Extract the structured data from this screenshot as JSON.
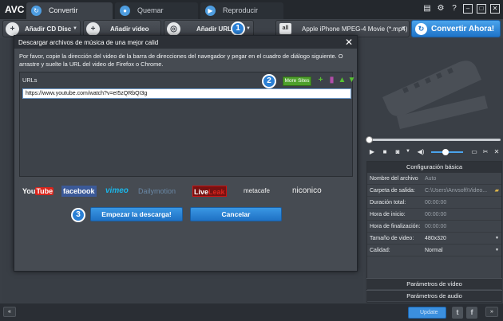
{
  "app": {
    "logo": "AVC"
  },
  "tabs": [
    {
      "label": "Convertir",
      "icon": "convert-icon",
      "active": true
    },
    {
      "label": "Quemar",
      "icon": "disc-icon",
      "active": false
    },
    {
      "label": "Reproducir",
      "icon": "play-icon",
      "active": false
    }
  ],
  "window": {
    "min": "–",
    "restore": "□",
    "close": "✕",
    "help": "?"
  },
  "toolbar": {
    "add_cd": "Añadir CD Disc",
    "add_video": "Añadir video",
    "add_url": "Añadir URL",
    "profile": "Apple iPhone MPEG-4 Movie (*.mp4)",
    "profile_icon_text": "all",
    "convert": "Convertir Ahora!"
  },
  "badges": {
    "one": "1",
    "two": "2",
    "three": "3"
  },
  "dialog": {
    "title": "Descargar archivos de música de una mejor calid",
    "description": "Por favor, copie la dirección del video de la barra de direcciones del navegador y pegar en el cuadro de diálogo siguiente. O arrastre y suelte la URL del video de Firefox o Chrome.",
    "urls_label": "URLs",
    "more_sites": "More Sites",
    "url_value": "https://www.youtube.com/watch?v=eI5zQRbQI3g",
    "start": "Empezar la descarga!",
    "cancel": "Cancelar"
  },
  "sites": {
    "youtube_you": "You",
    "youtube_tube": "Tube",
    "facebook": "facebook",
    "vimeo": "vimeo",
    "dailymotion": "Dailymotion",
    "liveleak_live": "Live",
    "liveleak_leak": "Leak",
    "metacafe": "metacafe",
    "niconico": "niconico"
  },
  "settings": {
    "header": "Configuración básica",
    "rows": [
      {
        "label": "Nombre del archivo",
        "value": "Auto"
      },
      {
        "label": "Carpeta de salida:",
        "value": "C:\\Users\\Anvsoft\\Video..."
      },
      {
        "label": "Duración total:",
        "value": "00:00:00"
      },
      {
        "label": "Hora de inicio:",
        "value": "00:00:00"
      },
      {
        "label": "Hora de finalización:",
        "value": "00:00:00"
      },
      {
        "label": "Tamaño de video:",
        "value": "480x320"
      },
      {
        "label": "Calidad:",
        "value": "Normal"
      }
    ],
    "video_params": "Parámetros de vídeo",
    "audio_params": "Parámetros de audio"
  },
  "bottom": {
    "collapse": "«",
    "update": "Update",
    "twitter": "t",
    "facebook": "f",
    "expand": "»"
  },
  "colors": {
    "accent": "#2a7fd4",
    "convert": "#1f74c8",
    "more_sites": "#4ea02c"
  }
}
